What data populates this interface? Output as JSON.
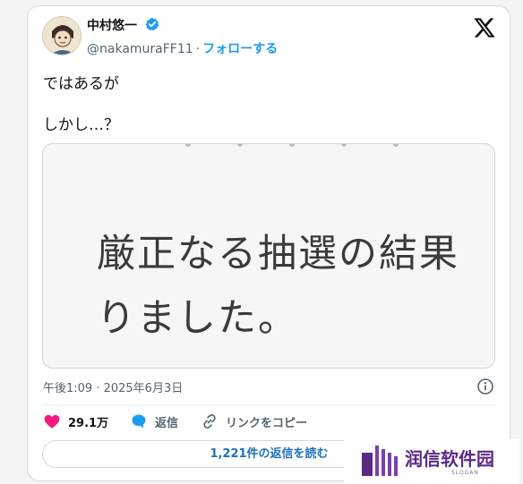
{
  "author": {
    "display_name": "中村悠一",
    "handle": "@nakamuraFF11",
    "separator": "·",
    "follow_label": "フォローする"
  },
  "tweet": {
    "lines": [
      "ではあるが",
      "しかし…？"
    ],
    "media_text": [
      "厳正なる抽選の結果",
      "りました。"
    ],
    "timestamp": "午後1:09 · 2025年6月3日"
  },
  "actions": {
    "like_count": "29.1万",
    "reply_label": "返信",
    "copy_label": "リンクをコピー"
  },
  "replies_button_label": "1,221件の返信を読む",
  "watermark": {
    "title": "润信软件园",
    "subtitle": "SLOGAN"
  },
  "colors": {
    "accent": "#1d9bf0",
    "like": "#f91880",
    "watermark": "#5b2a86"
  },
  "icons": {
    "verified": "verified-badge-icon",
    "brand": "x-logo-icon",
    "info": "info-icon",
    "like": "heart-icon",
    "reply": "speech-bubble-icon",
    "copy": "link-icon"
  }
}
